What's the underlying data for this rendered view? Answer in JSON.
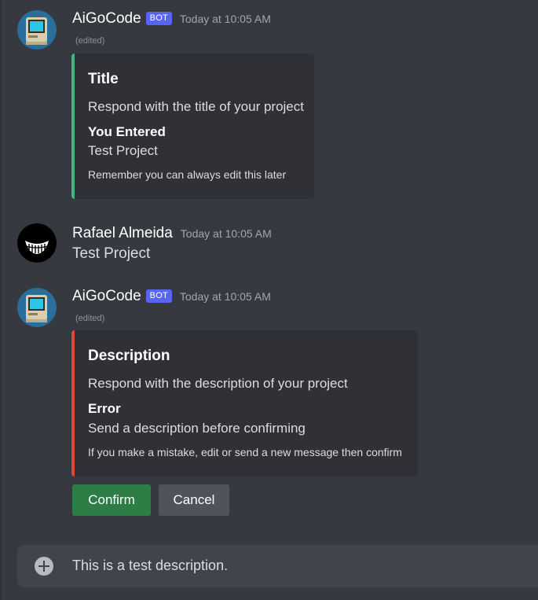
{
  "messages": [
    {
      "author": "AiGoCode",
      "bot_tag": "BOT",
      "timestamp": "Today at 10:05 AM",
      "edited": "(edited)",
      "embed": {
        "color": "#43b581",
        "title": "Title",
        "description": "Respond with the title of your project",
        "field_name": "You Entered",
        "field_value": "Test Project",
        "footer": "Remember you can always edit this later"
      }
    },
    {
      "author": "Rafael Almeida",
      "timestamp": "Today at 10:05 AM",
      "content": "Test Project"
    },
    {
      "author": "AiGoCode",
      "bot_tag": "BOT",
      "timestamp": "Today at 10:05 AM",
      "edited": "(edited)",
      "embed": {
        "color": "#e0463e",
        "title": "Description",
        "description": "Respond with the description of your project",
        "field_name": "Error",
        "field_value": "Send a description before confirming",
        "footer": "If you make a mistake, edit or send a new message then confirm"
      },
      "buttons": {
        "confirm": "Confirm",
        "cancel": "Cancel"
      }
    }
  ],
  "composer": {
    "value": "This is a test description.",
    "attach_icon": "plus-circle-icon"
  },
  "colors": {
    "background": "#36393f",
    "embed_bg": "#2f3136",
    "bot_tag": "#5865f2",
    "confirm": "#2d7d46",
    "cancel": "#4f545c"
  }
}
